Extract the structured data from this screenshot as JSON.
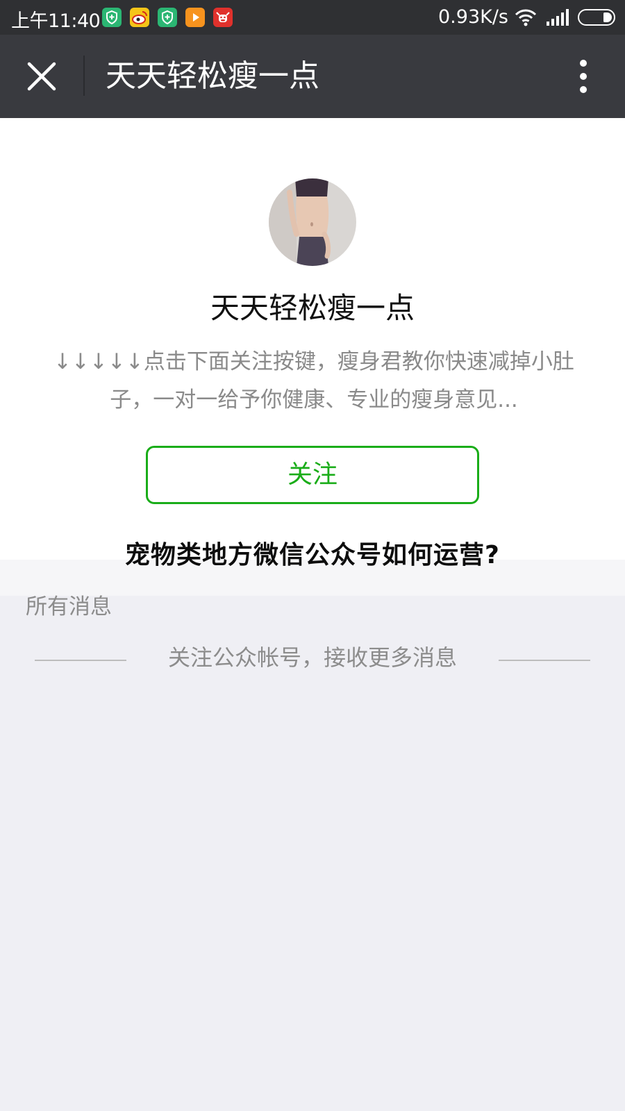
{
  "status_bar": {
    "time": "上午11:40",
    "network_speed": "0.93K/s",
    "icons": [
      "shield-app-icon",
      "weibo-icon",
      "shield-app-icon",
      "video-player-icon",
      "cattle-app-icon",
      "wifi-icon",
      "signal-icon",
      "battery-icon"
    ]
  },
  "title_bar": {
    "title": "天天轻松瘦一点",
    "close_icon": "close-icon",
    "more_icon": "more-vertical-icon"
  },
  "profile": {
    "name": "天天轻松瘦一点",
    "description": "↓↓↓↓↓点击下面关注按键，瘦身君教你快速减掉小肚子，一对一给予你健康、专业的瘦身意见...",
    "follow_label": "关注"
  },
  "overlay": {
    "title": "宠物类地方微信公众号如何运营?"
  },
  "messages": {
    "section_label": "所有消息",
    "notice": "关注公众帐号，接收更多消息"
  },
  "colors": {
    "status_bar_bg": "#2f3033",
    "title_bar_bg": "#393a3f",
    "accent_green": "#1aad19",
    "page_bg": "#efeff4"
  }
}
